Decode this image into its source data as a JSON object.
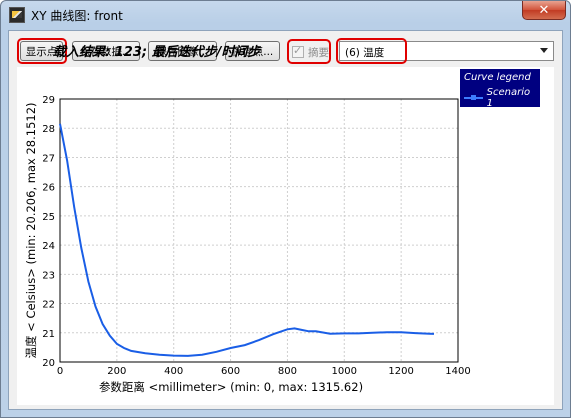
{
  "window": {
    "title": "XY 曲线图: front",
    "close_label": "✕"
  },
  "toolbar": {
    "show_points": "显示点",
    "save_data": "保存数据...",
    "save_image": "保存图像...",
    "save_points": "保存点...",
    "summary": "摘要",
    "summary_checked": true,
    "variable_select": "(6) 温度"
  },
  "colors": {
    "curve": "#1a5ee6",
    "legend_bg": "#000080",
    "highlight": "#e00000"
  },
  "chart_data": {
    "type": "line",
    "title": "载入结果: 123; 最后迭代步/时间步",
    "xlabel": "参数距离 <millimeter> (min: 0, max: 1315.62)",
    "ylabel": "温度 < Celsius> (min: 20.206, max 28.1512)",
    "xlim": [
      0,
      1400
    ],
    "ylim": [
      20,
      29
    ],
    "x_ticks": [
      0,
      200,
      400,
      600,
      800,
      1000,
      1200,
      1400
    ],
    "y_ticks": [
      20,
      21,
      22,
      23,
      24,
      25,
      26,
      27,
      28,
      29
    ],
    "grid": true,
    "legend_title": "Curve legend",
    "legend_position": "top-right",
    "series": [
      {
        "name": "Scenario 1",
        "x": [
          0,
          25,
          50,
          75,
          100,
          125,
          150,
          175,
          200,
          225,
          250,
          300,
          350,
          400,
          450,
          500,
          550,
          600,
          650,
          700,
          750,
          800,
          825,
          850,
          875,
          900,
          950,
          1000,
          1050,
          1100,
          1150,
          1200,
          1250,
          1300,
          1315.62
        ],
        "y": [
          28.15,
          26.9,
          25.3,
          23.9,
          22.75,
          21.9,
          21.3,
          20.9,
          20.62,
          20.48,
          20.38,
          20.3,
          20.25,
          20.22,
          20.21,
          20.25,
          20.35,
          20.48,
          20.58,
          20.75,
          20.95,
          21.12,
          21.15,
          21.1,
          21.05,
          21.05,
          20.97,
          20.98,
          20.98,
          21.0,
          21.02,
          21.02,
          20.99,
          20.97,
          20.96
        ]
      }
    ]
  }
}
